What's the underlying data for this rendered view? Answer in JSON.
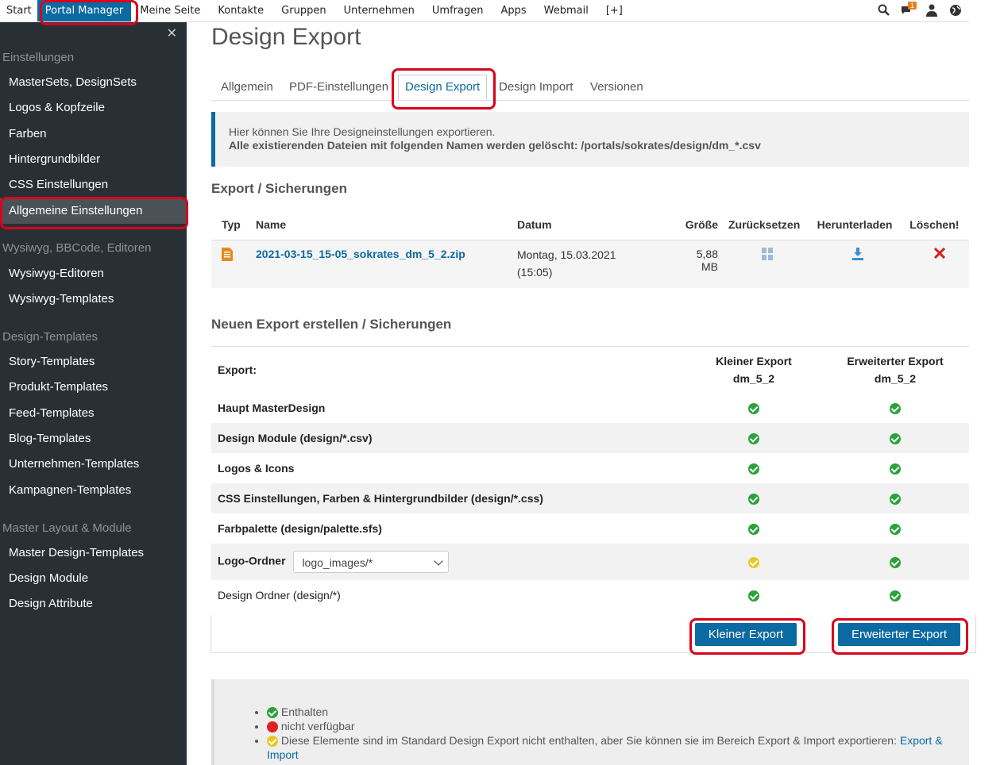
{
  "topnav": {
    "items": [
      "Start",
      "Portal Manager",
      "Meine Seite",
      "Kontakte",
      "Gruppen",
      "Unternehmen",
      "Umfragen",
      "Apps",
      "Webmail",
      "[+]"
    ],
    "active_index": 1,
    "icons": [
      "search-icon",
      "chat-icon",
      "user-icon",
      "globe-icon"
    ],
    "chat_badge": "1"
  },
  "sidebar": {
    "close_icon": "close-icon",
    "sections": [
      {
        "header": "Einstellungen",
        "items": [
          "MasterSets, DesignSets",
          "Logos & Kopfzeile",
          "Farben",
          "Hintergrundbilder",
          "CSS Einstellungen",
          "Allgemeine Einstellungen"
        ]
      },
      {
        "header": "Wysiwyg, BBCode, Editoren",
        "items": [
          "Wysiwyg-Editoren",
          "Wysiwyg-Templates"
        ]
      },
      {
        "header": "Design-Templates",
        "items": [
          "Story-Templates",
          "Produkt-Templates",
          "Feed-Templates",
          "Blog-Templates",
          "Unternehmen-Templates",
          "Kampagnen-Templates"
        ]
      },
      {
        "header": "Master Layout & Module",
        "items": [
          "Master Design-Templates",
          "Design Module",
          "Design Attribute"
        ]
      }
    ],
    "active_item": "Allgemeine Einstellungen"
  },
  "page": {
    "title": "Design Export",
    "tabs": [
      "Allgemein",
      "PDF-Einstellungen",
      "Design Export",
      "Design Import",
      "Versionen"
    ],
    "active_tab": "Design Export",
    "info_line1": "Hier können Sie Ihre Designeinstellungen exportieren.",
    "info_line2": "Alle existierenden Dateien mit folgenden Namen werden gelöscht: /portals/sokrates/design/dm_*.csv"
  },
  "files": {
    "section_title": "Export / Sicherungen",
    "headers": {
      "type": "Typ",
      "name": "Name",
      "date": "Datum",
      "size": "Größe",
      "restore": "Zurücksetzen",
      "download": "Herunterladen",
      "delete": "Löschen!"
    },
    "rows": [
      {
        "name": "2021-03-15_15-05_sokrates_dm_5_2.zip",
        "date_line1": "Montag, 15.03.2021",
        "date_line2": "(15:05)",
        "size": "5,88 MB"
      }
    ]
  },
  "export": {
    "section_title": "Neuen Export erstellen / Sicherungen",
    "header_label": "Export:",
    "col_small_line1": "Kleiner Export",
    "col_small_line2": "dm_5_2",
    "col_ext_line1": "Erweiterter Export",
    "col_ext_line2": "dm_5_2",
    "rows": [
      {
        "label": "Haupt MasterDesign",
        "small": "green",
        "ext": "green"
      },
      {
        "label": "Design Module (design/*.csv)",
        "small": "green",
        "ext": "green"
      },
      {
        "label": "Logos & Icons",
        "small": "green",
        "ext": "green"
      },
      {
        "label": "CSS Einstellungen, Farben & Hintergrundbilder (design/*.css)",
        "small": "green",
        "ext": "green"
      },
      {
        "label": "Farbpalette (design/palette.sfs)",
        "small": "green",
        "ext": "green"
      },
      {
        "label": "Logo-Ordner",
        "select_value": "logo_images/*",
        "small": "yellow",
        "ext": "green"
      },
      {
        "label": "Design Ordner (design/*)",
        "small": "green",
        "ext": "green"
      }
    ],
    "btn_small": "Kleiner Export",
    "btn_ext": "Erweiterter Export"
  },
  "legend": {
    "items": [
      "Enthalten",
      "nicht verfügbar",
      "Diese Elemente sind im Standard Design Export nicht enthalten, aber Sie können sie im Bereich Export & Import exportieren:"
    ],
    "link": "Export & Import"
  },
  "colors": {
    "accent": "#0b6aa1",
    "sidebar_bg": "#283035",
    "highlight": "#d9001b",
    "green": "#2aa33a",
    "yellow": "#e8c923",
    "red": "#e02020"
  }
}
